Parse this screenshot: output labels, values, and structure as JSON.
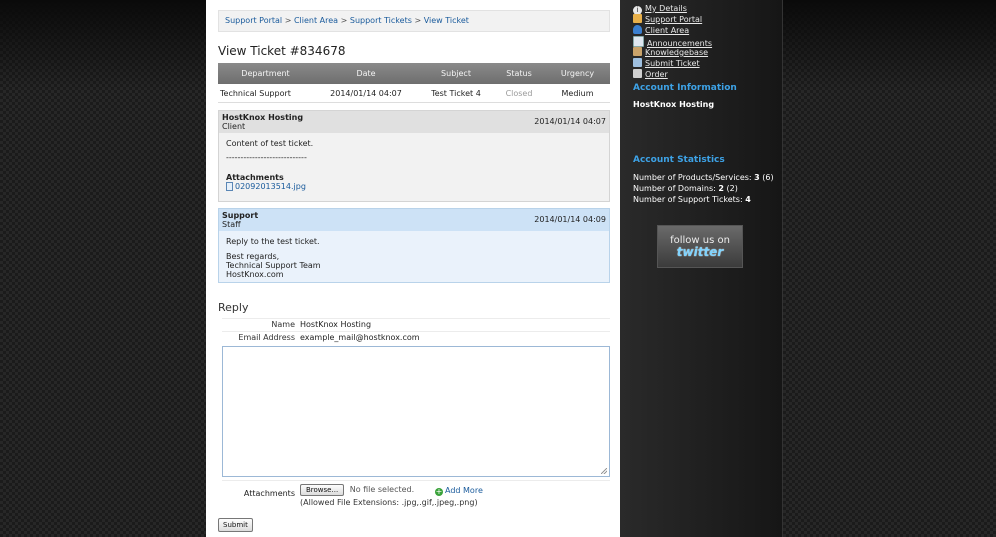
{
  "breadcrumb": [
    "Support Portal",
    "Client Area",
    "Support Tickets",
    "View Ticket"
  ],
  "breadcrumb_sep": ">",
  "page_title": "View Ticket #834678",
  "ticket_table": {
    "headers": [
      "Department",
      "Date",
      "Subject",
      "Status",
      "Urgency"
    ],
    "row": [
      "Technical Support",
      "2014/01/14 04:07",
      "Test Ticket 4",
      "Closed",
      "Medium"
    ]
  },
  "messages": [
    {
      "author": "HostKnox Hosting",
      "role": "Client",
      "date": "2014/01/14 04:07",
      "body": [
        "Content of test ticket.",
        "----------------------------"
      ],
      "attachments_label": "Attachments",
      "attachment": "02092013514.jpg"
    },
    {
      "author": "Support",
      "role": "Staff",
      "date": "2014/01/14 04:09",
      "body": [
        "Reply to the test ticket.",
        "Best regards,",
        "Technical Support Team",
        "HostKnox.com"
      ]
    }
  ],
  "reply": {
    "title": "Reply",
    "name_label": "Name",
    "name_value": "HostKnox Hosting",
    "email_label": "Email Address",
    "email_value": "example_mail@hostknox.com",
    "attachments_label": "Attachments",
    "browse_label": "Browse...",
    "no_file": "No file selected.",
    "add_more": "Add More",
    "allowed": "(Allowed File Extensions: .jpg,.gif,.jpeg,.png)",
    "submit": "Submit"
  },
  "sidebar": {
    "nav": [
      "My Details",
      "Support Portal",
      "Client Area",
      "Announcements",
      "Knowledgebase",
      "Submit Ticket",
      "Order"
    ],
    "account_info_title": "Account Information",
    "account_name": "HostKnox Hosting",
    "stats_title": "Account Statistics",
    "stats": [
      {
        "label": "Number of Products/Services:",
        "value": "3",
        "extra": "(6)"
      },
      {
        "label": "Number of Domains:",
        "value": "2",
        "extra": "(2)"
      },
      {
        "label": "Number of Support Tickets:",
        "value": "4",
        "extra": ""
      }
    ],
    "follow_line1": "follow us on",
    "follow_line2": "twitter"
  }
}
